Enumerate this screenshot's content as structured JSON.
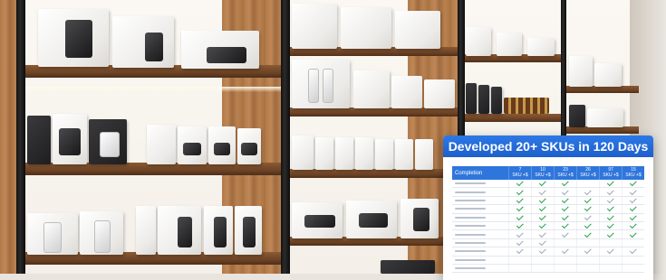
{
  "overlay": {
    "title": "Developed 20+ SKUs in 120 Days",
    "table": {
      "first_header": "Completion",
      "headers": [
        {
          "l1": "7",
          "l2": "SKU +$"
        },
        {
          "l1": "10",
          "l2": "SKU +$"
        },
        {
          "l1": "23",
          "l2": "SKU +$"
        },
        {
          "l1": "26",
          "l2": "SKU +$"
        },
        {
          "l1": "97",
          "l2": "SKU +$"
        },
        {
          "l1": "15",
          "l2": "SKU +$"
        }
      ],
      "rows": [
        [
          "g",
          "g",
          "g",
          "n",
          "g",
          "g"
        ],
        [
          "g",
          "k",
          "k",
          "k",
          "k",
          "k"
        ],
        [
          "g",
          "g",
          "g",
          "g",
          "k",
          "k"
        ],
        [
          "g",
          "g",
          "g",
          "g",
          "g",
          "g"
        ],
        [
          "g",
          "g",
          "g",
          "k",
          "g",
          "g"
        ],
        [
          "g",
          "g",
          "g",
          "g",
          "g",
          "g"
        ],
        [
          "k",
          "k",
          "k",
          "g",
          "g",
          "g"
        ],
        [
          "k",
          "k",
          "n",
          "n",
          "n",
          "n"
        ],
        [
          "k",
          "k",
          "k",
          "k",
          "k",
          "k"
        ],
        [
          "n",
          "n",
          "n",
          "n",
          "n",
          "n"
        ],
        [
          "n",
          "n",
          "n",
          "n",
          "n",
          "n"
        ]
      ]
    }
  },
  "colors": {
    "header_blue": "#1d5fcb",
    "check_green": "#22a046",
    "check_grey": "#9ba5b3"
  }
}
